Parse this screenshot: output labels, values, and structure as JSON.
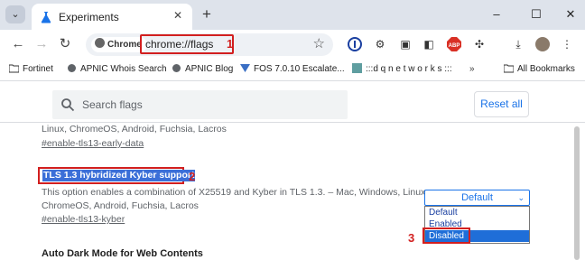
{
  "tabs": {
    "active_title": "Experiments",
    "new_tab_symbol": "+"
  },
  "window_controls": {
    "minimize": "–",
    "maximize": "☐",
    "close": "✕"
  },
  "toolbar": {
    "security_chip": "Chrome",
    "url": "chrome://flags",
    "annotation_1": "1"
  },
  "bookmarks": {
    "items": [
      {
        "label": "Fortinet",
        "icon": "folder-icon"
      },
      {
        "label": "APNIC Whois Search",
        "icon": "globe-icon"
      },
      {
        "label": "APNIC Blog",
        "icon": "globe-icon"
      },
      {
        "label": "FOS 7.0.10 Escalate...",
        "icon": "fortinet-icon"
      },
      {
        "label": ":::d q n e t w o r k s :::",
        "icon": "dq-icon"
      }
    ],
    "all_bookmarks": "All Bookmarks"
  },
  "page": {
    "search_placeholder": "Search flags",
    "reset_all": "Reset all",
    "prev_flag_desc": "Linux, ChromeOS, Android, Fuchsia, Lacros",
    "prev_flag_link": "#enable-tls13-early-data",
    "flag": {
      "title": "TLS 1.3 hybridized Kyber support",
      "annotation_2": "2",
      "desc_line1": "This option enables a combination of X25519 and Kyber in TLS 1.3. – Mac, Windows, Linux,",
      "desc_line2": "ChromeOS, Android, Fuchsia, Lacros",
      "link": "#enable-tls13-kyber",
      "select_value": "Default",
      "options": [
        "Default",
        "Enabled",
        "Disabled"
      ],
      "highlighted_option": "Disabled",
      "annotation_3": "3"
    },
    "next_flag_title": "Auto Dark Mode for Web Contents"
  },
  "colors": {
    "annotation_red": "#d21f1f",
    "link_blue": "#1a73e8",
    "selection_blue": "#3b6fd8",
    "tabstrip_bg": "#dee3eb"
  }
}
